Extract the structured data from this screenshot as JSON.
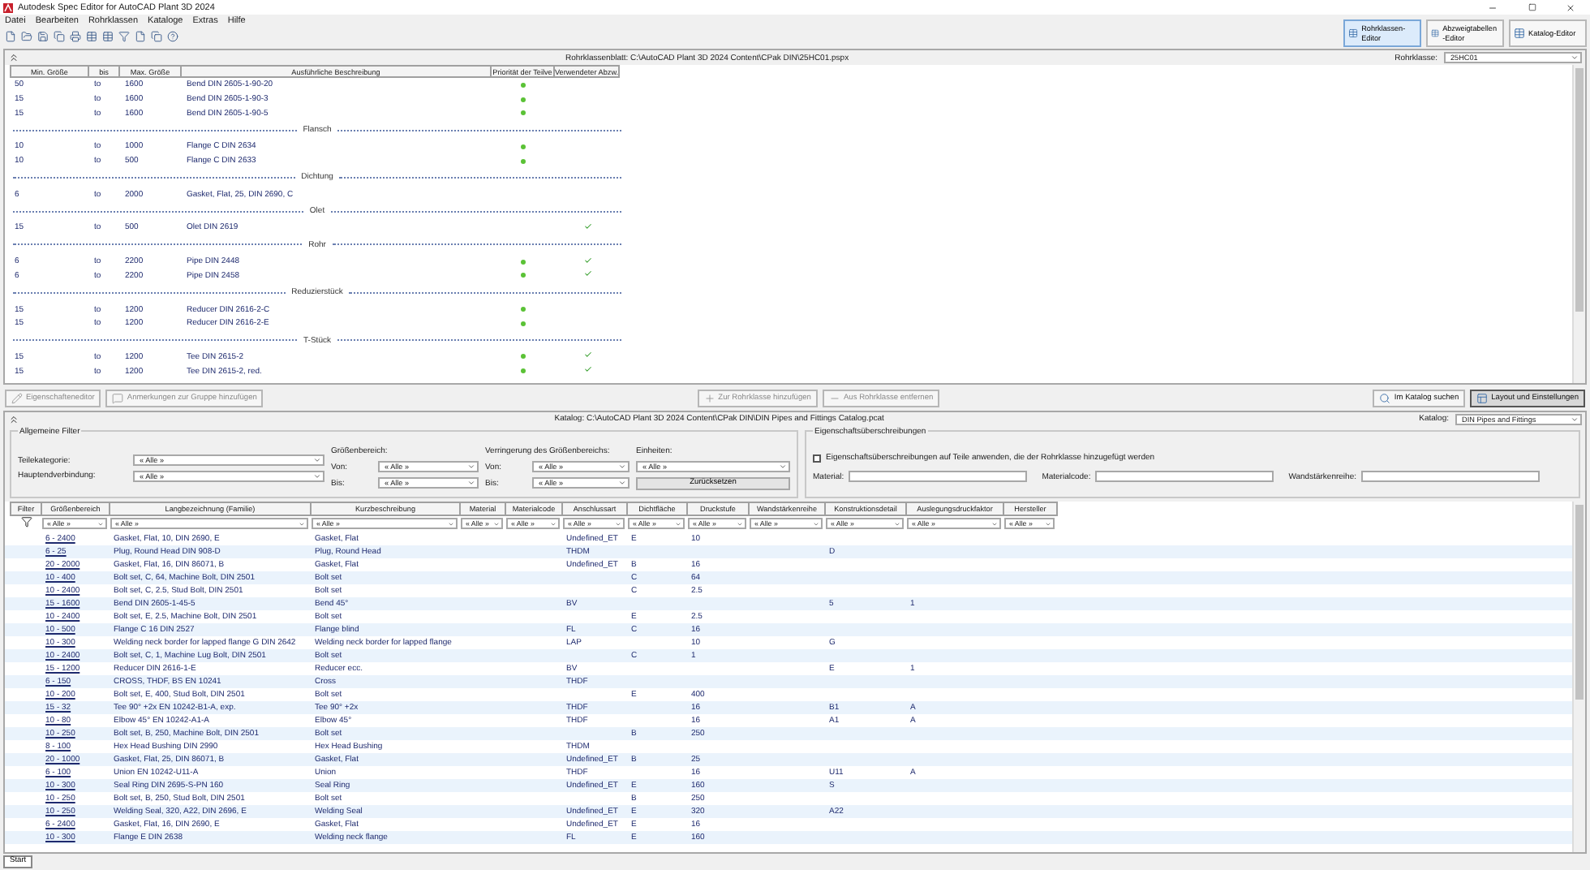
{
  "window": {
    "title": "Autodesk Spec Editor for AutoCAD Plant 3D 2024"
  },
  "menu": [
    "Datei",
    "Bearbeiten",
    "Rohrklassen",
    "Kataloge",
    "Extras",
    "Hilfe"
  ],
  "editor_tabs": [
    {
      "label": "Rohrklassen-Editor",
      "selected": true
    },
    {
      "label": "Abzweigtabellen -Editor",
      "selected": false
    },
    {
      "label": "Katalog-Editor",
      "selected": false
    }
  ],
  "spec_sheet": {
    "title": "Rohrklassenblatt: C:\\AutoCAD Plant 3D 2024 Content\\CPak DIN\\25HC01.pspx",
    "class_label": "Rohrklasse:",
    "class_value": "25HC01",
    "columns": [
      "Min. Größe",
      "bis",
      "Max. Größe",
      "Ausführliche Beschreibung",
      "Priorität der Teilve",
      "Verwendeter Abzw."
    ],
    "rows": [
      {
        "kind": "part",
        "min": "50",
        "bis": "to",
        "max": "1600",
        "description": "Bend DIN 2605-1-90-20",
        "priority": true,
        "branch": false
      },
      {
        "kind": "part",
        "min": "15",
        "bis": "to",
        "max": "1600",
        "description": "Bend DIN 2605-1-90-3",
        "priority": true,
        "branch": false
      },
      {
        "kind": "part",
        "min": "15",
        "bis": "to",
        "max": "1600",
        "description": "Bend DIN 2605-1-90-5",
        "priority": true,
        "branch": false
      },
      {
        "kind": "group",
        "label": "Flansch"
      },
      {
        "kind": "part",
        "min": "10",
        "bis": "to",
        "max": "1000",
        "description": "Flange C DIN 2634",
        "priority": true,
        "branch": false
      },
      {
        "kind": "part",
        "min": "10",
        "bis": "to",
        "max": "500",
        "description": "Flange C DIN 2633",
        "priority": true,
        "branch": false
      },
      {
        "kind": "group",
        "label": "Dichtung"
      },
      {
        "kind": "part",
        "min": "6",
        "bis": "to",
        "max": "2000",
        "description": "Gasket, Flat, 25, DIN 2690, C",
        "priority": false,
        "branch": false
      },
      {
        "kind": "group",
        "label": "Olet"
      },
      {
        "kind": "part",
        "min": "15",
        "bis": "to",
        "max": "500",
        "description": "Olet DIN 2619",
        "priority": false,
        "branch": true
      },
      {
        "kind": "group",
        "label": "Rohr"
      },
      {
        "kind": "part",
        "min": "6",
        "bis": "to",
        "max": "2200",
        "description": "Pipe DIN 2448",
        "priority": true,
        "branch": true
      },
      {
        "kind": "part",
        "min": "6",
        "bis": "to",
        "max": "2200",
        "description": "Pipe DIN 2458",
        "priority": true,
        "branch": true
      },
      {
        "kind": "group",
        "label": "Reduzierstück"
      },
      {
        "kind": "part",
        "min": "15",
        "bis": "to",
        "max": "1200",
        "description": "Reducer DIN 2616-2-C",
        "priority": true,
        "branch": false
      },
      {
        "kind": "part",
        "min": "15",
        "bis": "to",
        "max": "1200",
        "description": "Reducer DIN 2616-2-E",
        "priority": true,
        "branch": false
      },
      {
        "kind": "group",
        "label": "T-Stück"
      },
      {
        "kind": "part",
        "min": "15",
        "bis": "to",
        "max": "1200",
        "description": "Tee DIN 2615-2",
        "priority": true,
        "branch": true
      },
      {
        "kind": "part",
        "min": "15",
        "bis": "to",
        "max": "1200",
        "description": "Tee DIN 2615-2, red.",
        "priority": true,
        "branch": true
      }
    ]
  },
  "actions": {
    "left": [
      {
        "label": "Eigenschafteneditor",
        "disabled": true,
        "pressed": false
      },
      {
        "label": "Anmerkungen zur Gruppe hinzufügen",
        "disabled": true,
        "pressed": false
      }
    ],
    "center": [
      {
        "label": "Zur Rohrklasse hinzufügen",
        "disabled": true,
        "pressed": false
      },
      {
        "label": "Aus Rohrklasse entfernen",
        "disabled": true,
        "pressed": false
      }
    ],
    "right": [
      {
        "label": "Im Katalog suchen",
        "disabled": false,
        "pressed": false
      },
      {
        "label": "Layout und Einstellungen",
        "disabled": false,
        "pressed": true
      }
    ]
  },
  "catalog": {
    "title": "Katalog: C:\\AutoCAD Plant 3D 2024 Content\\CPak DIN\\DIN Pipes and Fittings Catalog.pcat",
    "catalog_label": "Katalog:",
    "catalog_value": "DIN Pipes and Fittings",
    "general_filters": {
      "title": "Allgemeine Filter",
      "category_label": "Teilekategorie:",
      "category_value": "« Alle »",
      "end_label": "Hauptendverbindung:",
      "end_value": "« Alle »",
      "size_label": "Größenbereich:",
      "size_from_label": "Von:",
      "size_from": "« Alle »",
      "size_to_label": "Bis:",
      "size_to": "« Alle »",
      "reduce_label": "Verringerung des Größenbereichs:",
      "reduce_from_label": "Von:",
      "reduce_from": "« Alle »",
      "reduce_to_label": "Bis:",
      "reduce_to": "« Alle »",
      "units_label": "Einheiten:",
      "units_value": "« Alle »",
      "reset_button": "Zurücksetzen"
    },
    "overrides": {
      "title": "Eigenschaftsüberschreibungen",
      "apply_label": "Eigenschaftsüberschreibungen auf Teile anwenden, die der Rohrklasse hinzugefügt werden",
      "apply_checked": false,
      "material_label": "Material:",
      "matcode_label": "Materialcode:",
      "wall_label": "Wandstärkenreihe:"
    },
    "table": {
      "columns": [
        "Filter",
        "Größenbereich",
        "Langbezeichnung (Familie)",
        "Kurzbeschreibung",
        "Material",
        "Materialcode",
        "Anschlussart",
        "Dichtfläche",
        "Druckstufe",
        "Wandstärkenreihe",
        "Konstruktionsdetail",
        "Auslegungsdruckfaktor",
        "Hersteller"
      ],
      "filters": [
        "« Alle »",
        "« Alle »",
        "« Alle »",
        "« Alle »",
        "« Alle »",
        "« Alle »",
        "« Alle »",
        "« Alle »",
        "« Alle »",
        "« Alle »",
        "« Alle »",
        "« Alle »"
      ],
      "rows": [
        {
          "size": "6 - 2400",
          "long": "Gasket, Flat, 10, DIN 2690, E",
          "short": "Gasket, Flat",
          "conn": "Undefined_ET",
          "face": "E",
          "pressure": "10"
        },
        {
          "size": "6 - 25",
          "long": "Plug, Round Head DIN 908-D",
          "short": "Plug, Round Head",
          "conn": "THDM",
          "detail": "D"
        },
        {
          "size": "20 - 2000",
          "long": "Gasket, Flat, 16, DIN 86071, B",
          "short": "Gasket, Flat",
          "conn": "Undefined_ET",
          "face": "B",
          "pressure": "16"
        },
        {
          "size": "10 - 400",
          "long": "Bolt set, C, 64, Machine Bolt, DIN 2501",
          "short": "Bolt set",
          "face": "C",
          "pressure": "64"
        },
        {
          "size": "10 - 2400",
          "long": "Bolt set, C, 2.5, Stud Bolt, DIN 2501",
          "short": "Bolt set",
          "face": "C",
          "pressure": "2.5"
        },
        {
          "size": "15 - 1600",
          "long": "Bend DIN 2605-1-45-5",
          "short": "Bend 45°",
          "conn": "BV",
          "detail": "5",
          "factor": "1"
        },
        {
          "size": "10 - 2400",
          "long": "Bolt set, E, 2.5, Machine Bolt, DIN 2501",
          "short": "Bolt set",
          "face": "E",
          "pressure": "2.5"
        },
        {
          "size": "10 - 500",
          "long": "Flange C 16 DIN 2527",
          "short": "Flange blind",
          "conn": "FL",
          "face": "C",
          "pressure": "16"
        },
        {
          "size": "10 - 300",
          "long": "Welding neck border for lapped flange G DIN 2642",
          "short": "Welding neck border for lapped flange",
          "conn": "LAP",
          "pressure": "10",
          "detail": "G"
        },
        {
          "size": "10 - 2400",
          "long": "Bolt set, C, 1, Machine Lug Bolt, DIN 2501",
          "short": "Bolt set",
          "face": "C",
          "pressure": "1"
        },
        {
          "size": "15 - 1200",
          "long": "Reducer DIN 2616-1-E",
          "short": "Reducer ecc.",
          "conn": "BV",
          "detail": "E",
          "factor": "1"
        },
        {
          "size": "6 - 150",
          "long": "CROSS, THDF, BS EN 10241",
          "short": "Cross",
          "conn": "THDF"
        },
        {
          "size": "10 - 200",
          "long": "Bolt set, E, 400, Stud Bolt, DIN 2501",
          "short": "Bolt set",
          "face": "E",
          "pressure": "400"
        },
        {
          "size": "15 - 32",
          "long": "Tee 90° +2x EN 10242-B1-A, exp.",
          "short": "Tee 90° +2x",
          "conn": "THDF",
          "pressure": "16",
          "detail": "B1",
          "factor": "A"
        },
        {
          "size": "10 - 80",
          "long": "Elbow 45° EN 10242-A1-A",
          "short": "Elbow 45°",
          "conn": "THDF",
          "pressure": "16",
          "detail": "A1",
          "factor": "A"
        },
        {
          "size": "10 - 250",
          "long": "Bolt set, B, 250, Machine Bolt, DIN 2501",
          "short": "Bolt set",
          "face": "B",
          "pressure": "250"
        },
        {
          "size": "8 - 100",
          "long": "Hex Head Bushing DIN 2990",
          "short": "Hex Head Bushing",
          "conn": "THDM"
        },
        {
          "size": "20 - 1000",
          "long": "Gasket, Flat, 25, DIN 86071, B",
          "short": "Gasket, Flat",
          "conn": "Undefined_ET",
          "face": "B",
          "pressure": "25"
        },
        {
          "size": "6 - 100",
          "long": "Union EN 10242-U11-A",
          "short": "Union",
          "conn": "THDF",
          "pressure": "16",
          "detail": "U11",
          "factor": "A"
        },
        {
          "size": "10 - 300",
          "long": "Seal Ring DIN 2695-S-PN 160",
          "short": "Seal Ring",
          "conn": "Undefined_ET",
          "face": "E",
          "pressure": "160",
          "detail": "S"
        },
        {
          "size": "10 - 250",
          "long": "Bolt set, B, 250, Stud Bolt, DIN 2501",
          "short": "Bolt set",
          "face": "B",
          "pressure": "250"
        },
        {
          "size": "10 - 250",
          "long": "Welding Seal, 320, A22, DIN 2696, E",
          "short": "Welding Seal",
          "conn": "Undefined_ET",
          "face": "E",
          "pressure": "320",
          "detail": "A22"
        },
        {
          "size": "6 - 2400",
          "long": "Gasket, Flat, 16, DIN 2690, E",
          "short": "Gasket, Flat",
          "conn": "Undefined_ET",
          "face": "E",
          "pressure": "16"
        },
        {
          "size": "10 - 300",
          "long": "Flange E DIN 2638",
          "short": "Welding neck flange",
          "conn": "FL",
          "face": "E",
          "pressure": "160"
        }
      ]
    }
  },
  "status_bar": {
    "start_button": "Start"
  }
}
